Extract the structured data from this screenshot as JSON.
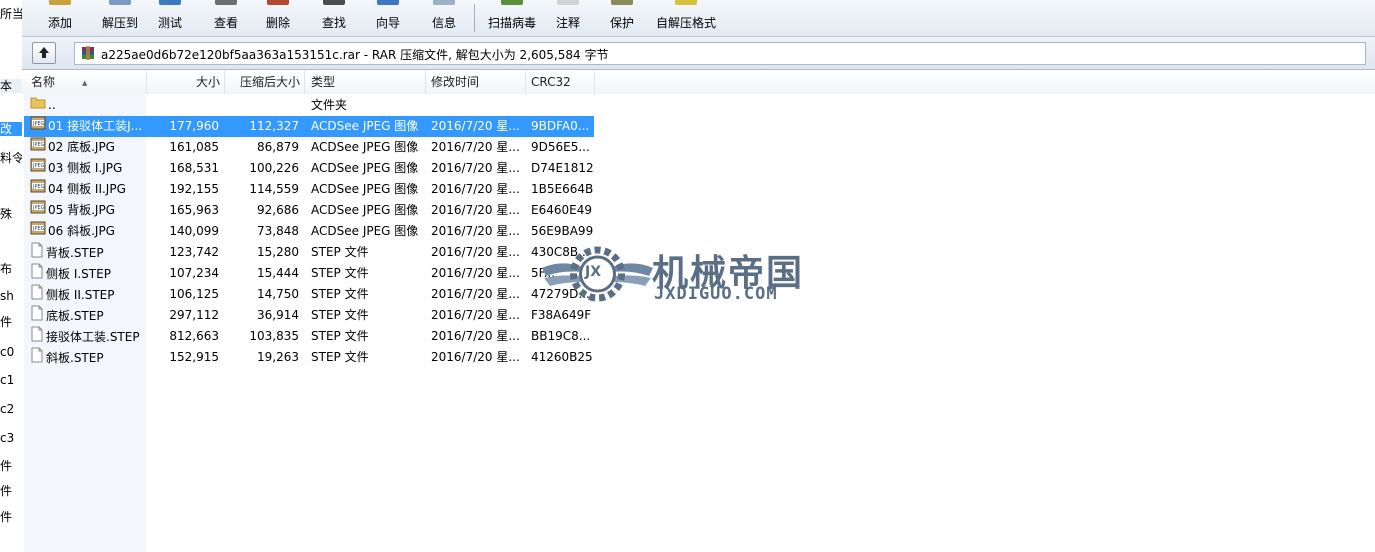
{
  "left_fragments": [
    "所当",
    "本",
    "改",
    "料令",
    "殊",
    "布",
    "sh",
    "件",
    "c0",
    "c1",
    "c2",
    "c3",
    "件",
    "件",
    "件"
  ],
  "toolbar": {
    "buttons": [
      {
        "label": "添加",
        "icon": "add-icon"
      },
      {
        "label": "解压到",
        "icon": "extract-icon"
      },
      {
        "label": "测试",
        "icon": "test-icon"
      },
      {
        "label": "查看",
        "icon": "view-icon"
      },
      {
        "label": "删除",
        "icon": "delete-icon"
      },
      {
        "label": "查找",
        "icon": "find-icon"
      },
      {
        "label": "向导",
        "icon": "wizard-icon"
      },
      {
        "label": "信息",
        "icon": "info-icon"
      },
      {
        "label": "扫描病毒",
        "icon": "virus-scan-icon"
      },
      {
        "label": "注释",
        "icon": "comment-icon"
      },
      {
        "label": "保护",
        "icon": "protect-icon"
      },
      {
        "label": "自解压格式",
        "icon": "sfx-icon"
      }
    ]
  },
  "address": {
    "path_text": "a225ae0d6b72e120bf5aa363a153151c.rar - RAR 压缩文件, 解包大小为 2,605,584 字节"
  },
  "columns": {
    "name": "名称",
    "size": "大小",
    "packed": "压缩后大小",
    "type": "类型",
    "modified": "修改时间",
    "crc": "CRC32"
  },
  "files": [
    {
      "name": "..",
      "size": "",
      "packed": "",
      "type": "文件夹",
      "modified": "",
      "crc": "",
      "icon": "folder-icon",
      "selected": false
    },
    {
      "name": "01 接驳体工装J...",
      "size": "177,960",
      "packed": "112,327",
      "type": "ACDSee JPEG 图像",
      "modified": "2016/7/20 星...",
      "crc": "9BDFA0...",
      "icon": "jpeg-icon",
      "selected": true
    },
    {
      "name": "02 底板.JPG",
      "size": "161,085",
      "packed": "86,879",
      "type": "ACDSee JPEG 图像",
      "modified": "2016/7/20 星...",
      "crc": "9D56E5...",
      "icon": "jpeg-icon",
      "selected": false
    },
    {
      "name": "03 侧板 I.JPG",
      "size": "168,531",
      "packed": "100,226",
      "type": "ACDSee JPEG 图像",
      "modified": "2016/7/20 星...",
      "crc": "D74E1812",
      "icon": "jpeg-icon",
      "selected": false
    },
    {
      "name": "04 侧板 II.JPG",
      "size": "192,155",
      "packed": "114,559",
      "type": "ACDSee JPEG 图像",
      "modified": "2016/7/20 星...",
      "crc": "1B5E664B",
      "icon": "jpeg-icon",
      "selected": false
    },
    {
      "name": "05 背板.JPG",
      "size": "165,963",
      "packed": "92,686",
      "type": "ACDSee JPEG 图像",
      "modified": "2016/7/20 星...",
      "crc": "E6460E49",
      "icon": "jpeg-icon",
      "selected": false
    },
    {
      "name": "06 斜板.JPG",
      "size": "140,099",
      "packed": "73,848",
      "type": "ACDSee JPEG 图像",
      "modified": "2016/7/20 星...",
      "crc": "56E9BA99",
      "icon": "jpeg-icon",
      "selected": false
    },
    {
      "name": "背板.STEP",
      "size": "123,742",
      "packed": "15,280",
      "type": "STEP 文件",
      "modified": "2016/7/20 星...",
      "crc": "430C8B...",
      "icon": "file-icon",
      "selected": false
    },
    {
      "name": "侧板 I.STEP",
      "size": "107,234",
      "packed": "15,444",
      "type": "STEP 文件",
      "modified": "2016/7/20 星...",
      "crc": "5F...",
      "icon": "file-icon",
      "selected": false
    },
    {
      "name": "侧板 II.STEP",
      "size": "106,125",
      "packed": "14,750",
      "type": "STEP 文件",
      "modified": "2016/7/20 星...",
      "crc": "47279D...",
      "icon": "file-icon",
      "selected": false
    },
    {
      "name": "底板.STEP",
      "size": "297,112",
      "packed": "36,914",
      "type": "STEP 文件",
      "modified": "2016/7/20 星...",
      "crc": "F38A649F",
      "icon": "file-icon",
      "selected": false
    },
    {
      "name": "接驳体工装.STEP",
      "size": "812,663",
      "packed": "103,835",
      "type": "STEP 文件",
      "modified": "2016/7/20 星...",
      "crc": "BB19C8...",
      "icon": "file-icon",
      "selected": false
    },
    {
      "name": "斜板.STEP",
      "size": "152,915",
      "packed": "19,263",
      "type": "STEP 文件",
      "modified": "2016/7/20 星...",
      "crc": "41260B25",
      "icon": "file-icon",
      "selected": false
    }
  ],
  "watermark": {
    "cn": "机械帝国",
    "en": "JXDIGUO.COM",
    "badge": "JX"
  },
  "colors": {
    "selection": "#3399ff",
    "toolbar_bg": "#e3eaf3",
    "watermark": "#5a6f86"
  }
}
